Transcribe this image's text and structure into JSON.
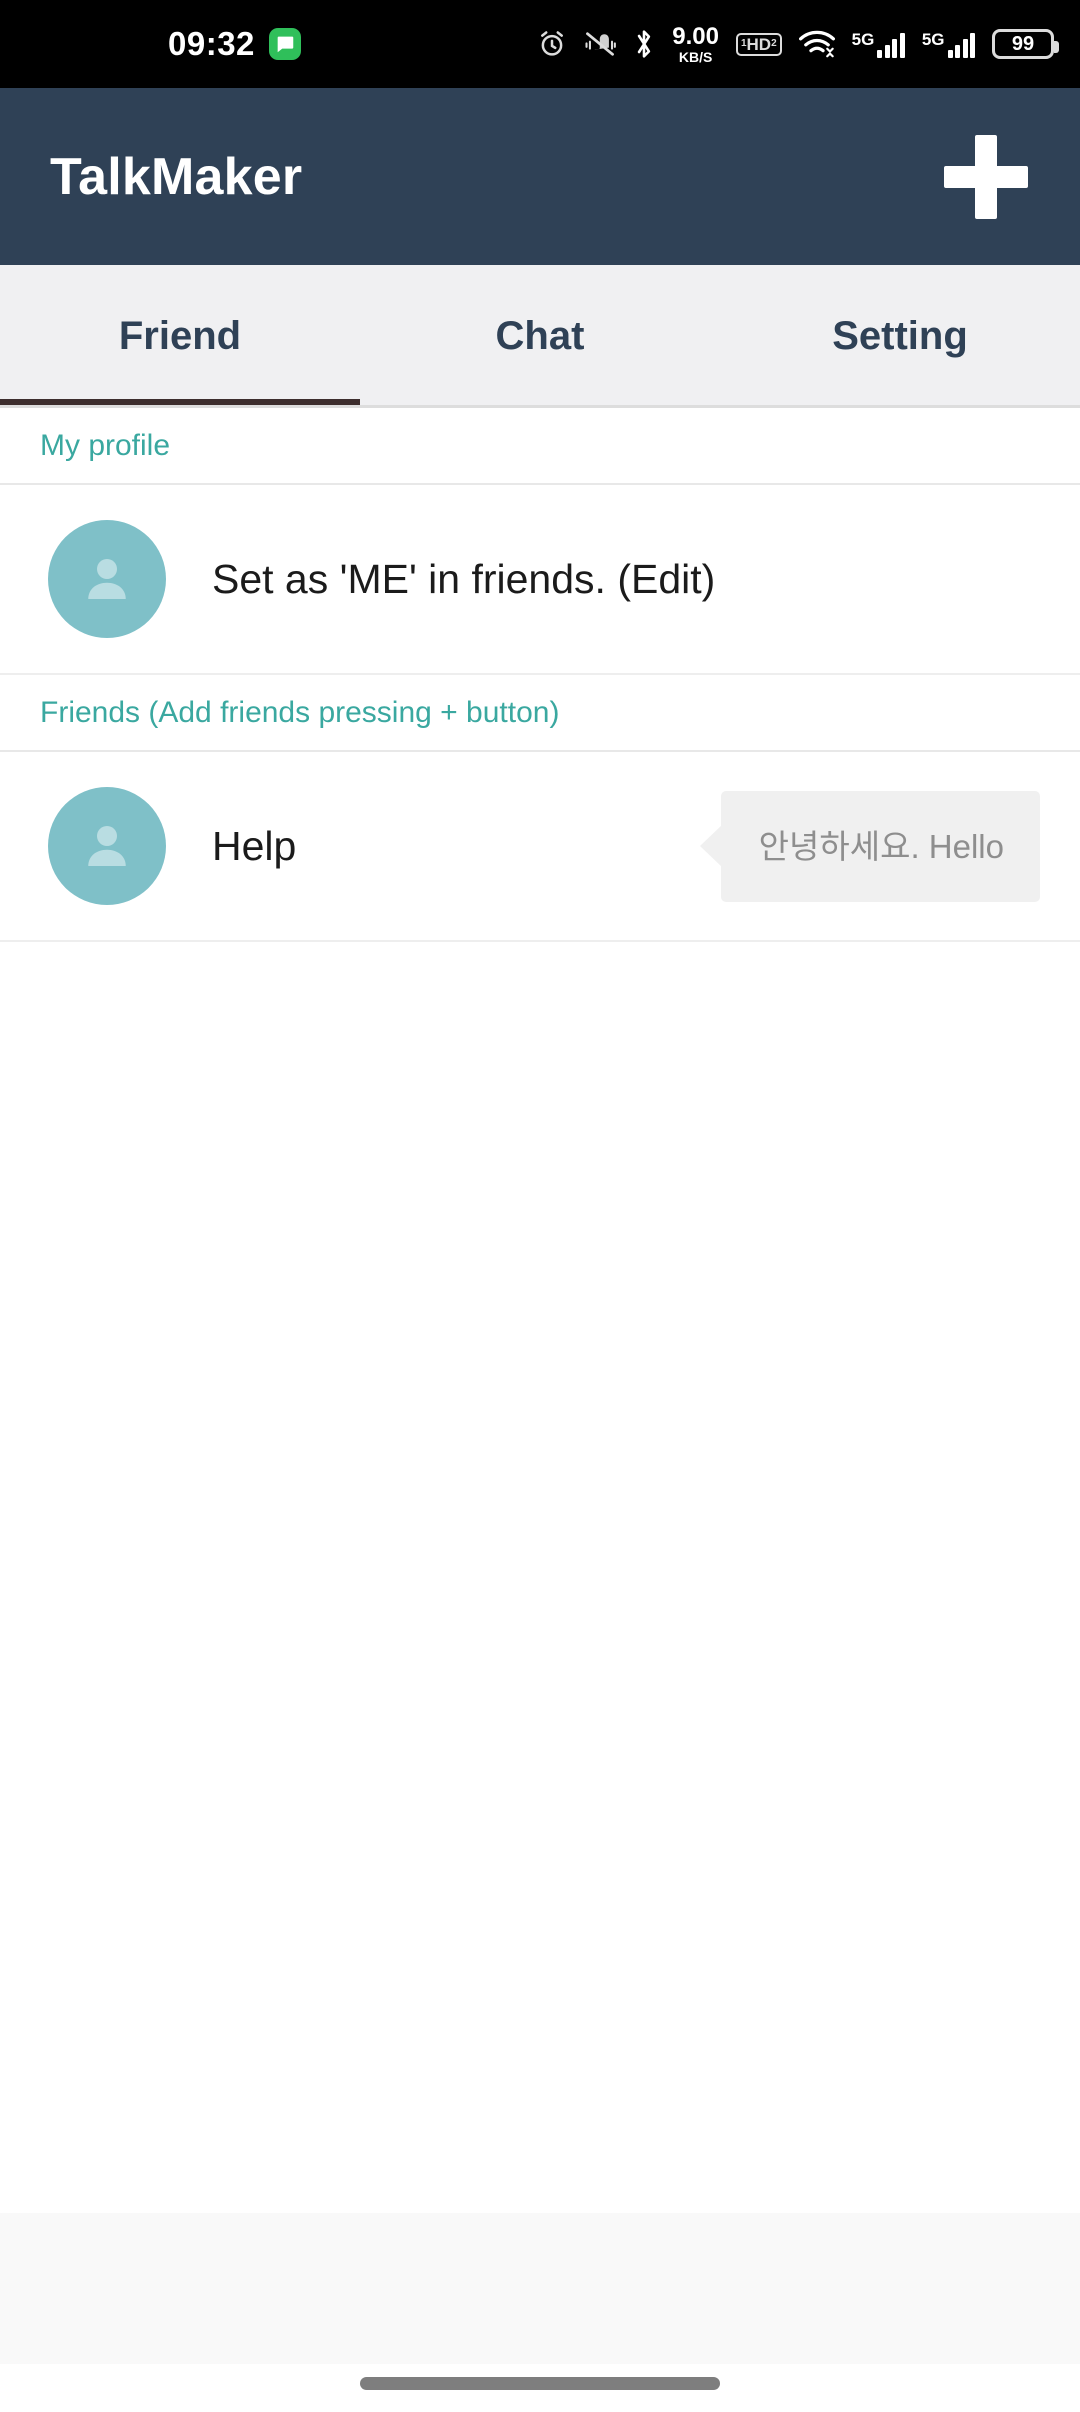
{
  "status_bar": {
    "time": "09:32",
    "notification_icon": "message-icon",
    "icons": [
      "alarm-icon",
      "mute-icon",
      "bluetooth-icon",
      "network-speed",
      "hd-voice-icon",
      "wifi-icon",
      "signal-5g-1",
      "signal-5g-2",
      "battery-icon"
    ],
    "network_speed_value": "9.00",
    "network_speed_unit": "KB/S",
    "hd_label": "HD",
    "hd_sup": "1",
    "hd_sub": "2",
    "sim1_label": "5G",
    "sim2_label": "5G",
    "battery_level": "99"
  },
  "app_bar": {
    "title": "TalkMaker",
    "add_button": "add-icon",
    "background": "#2f4156",
    "text_color": "#ffffff"
  },
  "tabs": {
    "active_index": 0,
    "indicator_color": "#3d2e2e",
    "items": [
      {
        "label": "Friend"
      },
      {
        "label": "Chat"
      },
      {
        "label": "Setting"
      }
    ]
  },
  "sections": [
    {
      "header": "My profile",
      "header_color": "#3aa8a0",
      "rows": [
        {
          "avatar": "person-avatar",
          "label": "Set as 'ME' in friends. (Edit)",
          "bubble": null
        }
      ]
    },
    {
      "header": "Friends (Add friends pressing + button)",
      "header_color": "#3aa8a0",
      "rows": [
        {
          "avatar": "person-avatar",
          "label": "Help",
          "bubble": "안녕하세요. Hello"
        }
      ]
    }
  ],
  "bottom": {
    "band_color": "#f9f9f9",
    "home_indicator": "home-indicator"
  }
}
